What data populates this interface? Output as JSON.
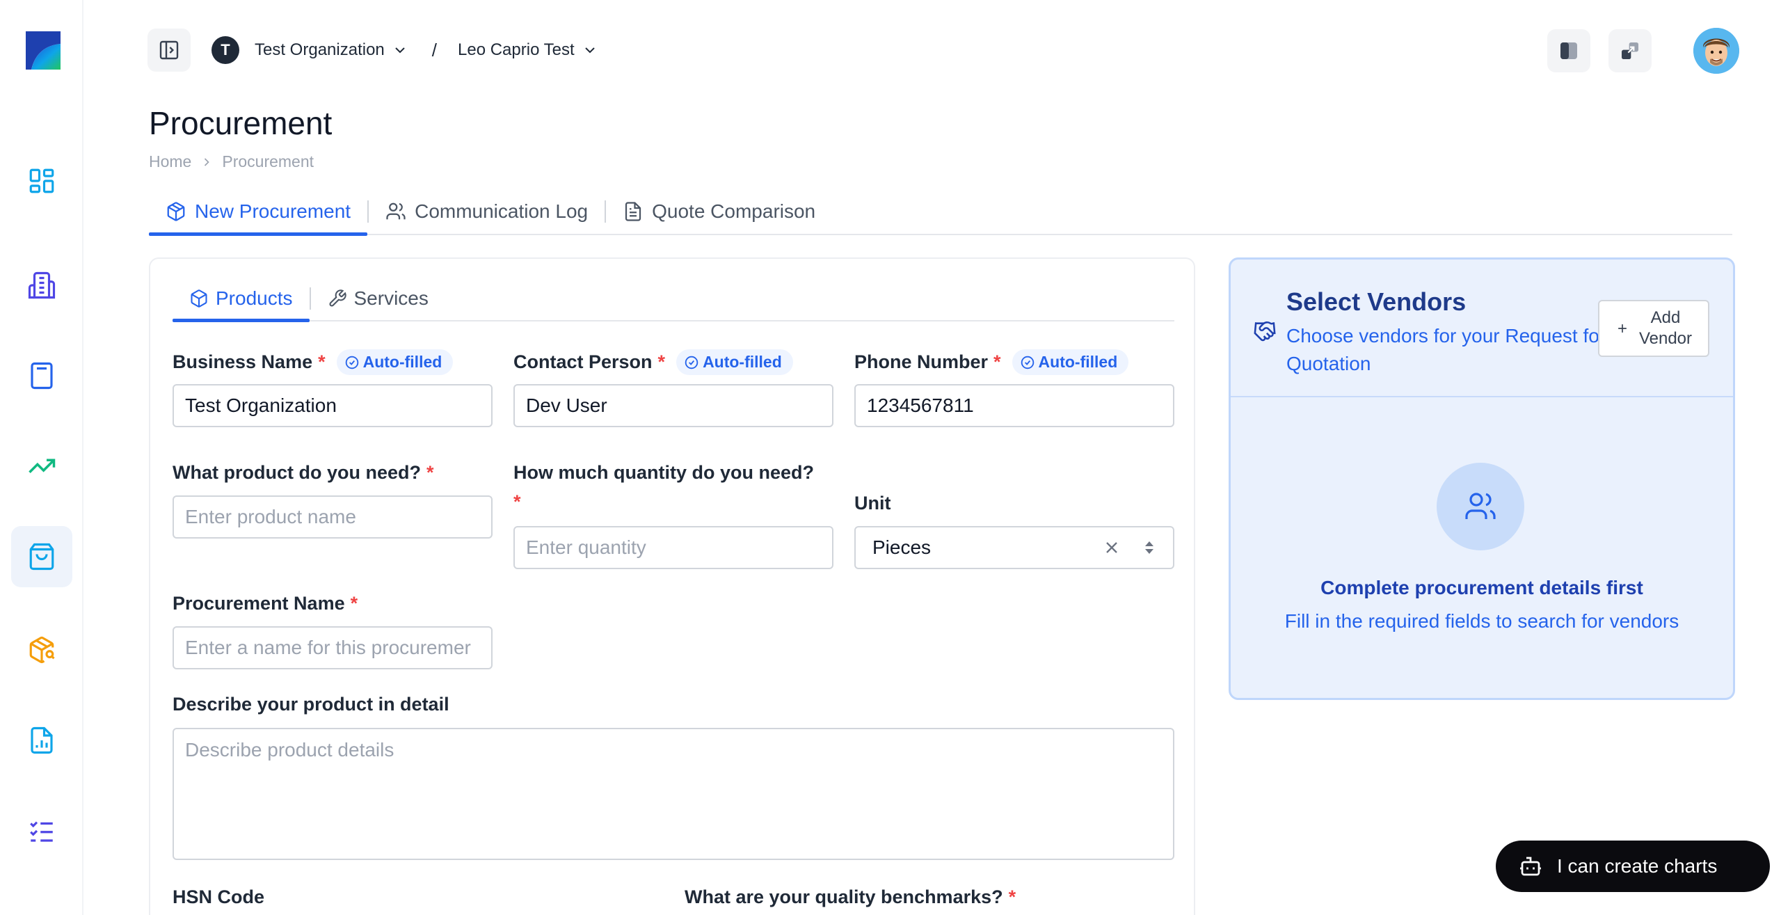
{
  "sidebar": {
    "items": [
      {
        "name": "dashboard",
        "icon": "grid-icon",
        "active": false
      },
      {
        "name": "organizations",
        "icon": "building-icon",
        "active": false
      },
      {
        "name": "calculator",
        "icon": "calculator-icon",
        "active": false
      },
      {
        "name": "analytics",
        "icon": "trending-up-icon",
        "active": false
      },
      {
        "name": "procurement",
        "icon": "shopping-bag-icon",
        "active": true
      },
      {
        "name": "inventory-search",
        "icon": "package-search-icon",
        "active": false
      },
      {
        "name": "reports",
        "icon": "file-chart-icon",
        "active": false
      },
      {
        "name": "tasks",
        "icon": "list-check-icon",
        "active": false
      }
    ]
  },
  "topbar": {
    "org_initial": "T",
    "org_name": "Test Organization",
    "separator": "/",
    "project_name": "Leo Caprio Test"
  },
  "header": {
    "title": "Procurement",
    "breadcrumb": [
      "Home",
      "Procurement"
    ]
  },
  "main_tabs": [
    {
      "label": "New Procurement",
      "active": true
    },
    {
      "label": "Communication Log",
      "active": false
    },
    {
      "label": "Quote Comparison",
      "active": false
    }
  ],
  "sub_tabs": [
    {
      "label": "Products",
      "active": true
    },
    {
      "label": "Services",
      "active": false
    }
  ],
  "form": {
    "auto_filled": "Auto-filled",
    "required_mark": "*",
    "business_name": {
      "label": "Business Name",
      "value": "Test Organization"
    },
    "contact_person": {
      "label": "Contact Person",
      "value": "Dev User"
    },
    "phone_number": {
      "label": "Phone Number",
      "value": "1234567811"
    },
    "product": {
      "label": "What product do you need?",
      "placeholder": "Enter product name"
    },
    "quantity": {
      "label": "How much quantity do you need?",
      "placeholder": "Enter quantity"
    },
    "unit": {
      "label": "Unit",
      "value": "Pieces"
    },
    "procurement_name": {
      "label": "Procurement Name",
      "placeholder": "Enter a name for this procuremer"
    },
    "description": {
      "label": "Describe your product in detail",
      "placeholder": "Describe product details"
    },
    "hsn": {
      "label": "HSN Code"
    },
    "quality": {
      "label": "What are your quality benchmarks?"
    }
  },
  "vendors": {
    "title": "Select Vendors",
    "subtitle": "Choose vendors for your Request for Quotation",
    "add_label_line1": "Add",
    "add_label_line2": "Vendor",
    "empty_title": "Complete procurement details first",
    "empty_subtitle": "Fill in the required fields to search for vendors"
  },
  "chat": {
    "label": "I can create charts"
  },
  "colors": {
    "accent": "#2563eb",
    "required": "#ef4444",
    "vendor_bg": "#eaf1fd"
  }
}
